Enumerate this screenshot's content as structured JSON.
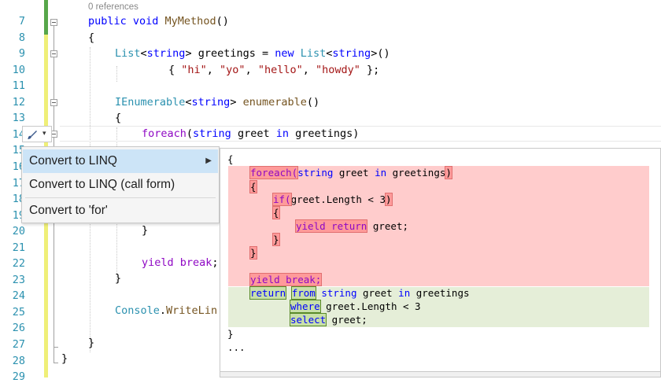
{
  "editor": {
    "line_numbers": [
      "7",
      "8",
      "9",
      "10",
      "11",
      "12",
      "13",
      "14",
      "15",
      "16",
      "17",
      "18",
      "19",
      "20",
      "21",
      "22",
      "23",
      "24",
      "25",
      "26",
      "27",
      "28",
      "29"
    ],
    "codelens": "0 references",
    "lines": {
      "l7": {
        "kw": "public void ",
        "mt": "MyMethod",
        "rest": "()"
      },
      "l8": "{",
      "l9": {
        "t1": "List",
        "t2": "<",
        "t3": "string",
        "t4": "> greetings = ",
        "kw": "new ",
        "t5": "List",
        "t6": "<",
        "t7": "string",
        "t8": ">()"
      },
      "l10": {
        "a": "{ ",
        "s1": "\"hi\"",
        "b": ", ",
        "s2": "\"yo\"",
        "c": ", ",
        "s3": "\"hello\"",
        "d": ", ",
        "s4": "\"howdy\"",
        "e": " };"
      },
      "l12": {
        "ty": "IEnumerable",
        "a": "<",
        "kw": "string",
        "b": "> ",
        "mt": "enumerable",
        "c": "()"
      },
      "l13": "{",
      "l14": {
        "pu": "foreach",
        "a": "(",
        "kw": "string",
        "b": " greet ",
        "kw2": "in",
        "c": " greetings)"
      },
      "l20": "}",
      "l22": {
        "pu": "yield break",
        "a": ";"
      },
      "l23": "}",
      "l25": {
        "ty": "Console",
        "a": ".",
        "mt": "WriteLin"
      },
      "l27": "}",
      "l28": "}"
    }
  },
  "lightbulb": {
    "icon": "brush-icon",
    "caret": "▾"
  },
  "menu": {
    "items": [
      {
        "label": "Convert to LINQ",
        "selected": true,
        "arrow": "▶"
      },
      {
        "label": "Convert to LINQ (call form)"
      },
      {
        "label": "Convert to 'for'"
      }
    ]
  },
  "preview": {
    "open_brace": "{",
    "close_brace": "}",
    "ellipsis": "...",
    "removed": {
      "foreach_kw": "foreach(",
      "foreach_string": "string",
      "foreach_mid": " greet ",
      "foreach_in": "in",
      "foreach_tail": " greetings",
      "foreach_close": ")",
      "brace_open": "{",
      "if_kw": "if(",
      "if_mid": "greet.Length < 3",
      "if_close": ")",
      "inner_open": "{",
      "yield_return": "yield return",
      "yield_tail": " greet;",
      "inner_close": "}",
      "brace_close": "}",
      "yield_break": "yield break;"
    },
    "added": {
      "return_kw": "return",
      "from_kw": "from",
      "string_kw": "string",
      "from_mid": " greet ",
      "in_kw": "in",
      "from_tail": " greetings",
      "where_kw": "where",
      "where_tail": " greet.Length < 3",
      "select_kw": "select",
      "select_tail": " greet;"
    }
  },
  "colors": {
    "keyword": "#0000ff",
    "type": "#2b91af",
    "string": "#a31515",
    "control": "#8f08c4",
    "removed_bg": "#ffcccc",
    "added_bg": "#e5eed8",
    "selection": "#cce4f7"
  }
}
